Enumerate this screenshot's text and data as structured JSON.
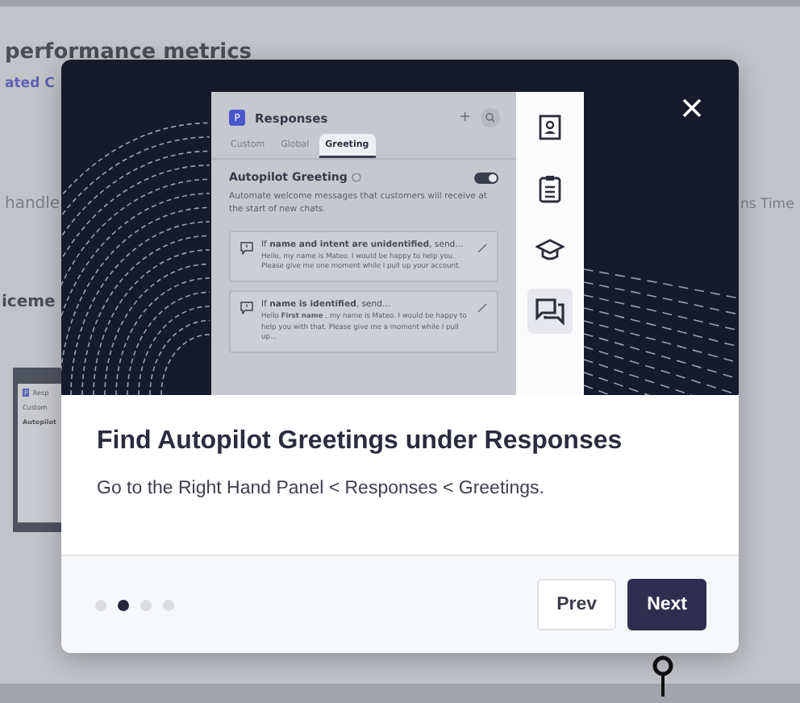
{
  "background": {
    "heading": "performance metrics",
    "link": "ated C",
    "label_left": "handle",
    "label_right": "ns Time",
    "section": "iceme",
    "thumbnail": {
      "badge": "P",
      "title": "Resp",
      "tab": "Custom",
      "heading": "Autopilot"
    }
  },
  "modal": {
    "preview": {
      "badge": "P",
      "title": "Responses",
      "add": "+",
      "tabs": [
        {
          "label": "Custom",
          "selected": false
        },
        {
          "label": "Global",
          "selected": false
        },
        {
          "label": "Greeting",
          "selected": true
        }
      ],
      "section": {
        "title": "Autopilot Greeting",
        "on": true,
        "description": "Automate welcome messages that customers will receive at the start of new chats."
      },
      "cards": [
        {
          "condition": "If **name and intent are unidentified**, send...",
          "message": "Hello, my name is Mateo. I would be happy to help you. Please give me one moment while I pull up your account."
        },
        {
          "condition": "If **name is identified**, send...",
          "message": "Hello **First name** , my name is Mateo. I would be happy to help you with that. Please give me a moment while I pull up..."
        }
      ],
      "rail": [
        {
          "kind": "contact",
          "selected": false
        },
        {
          "kind": "clipboard",
          "selected": false
        },
        {
          "kind": "course",
          "selected": false
        },
        {
          "kind": "chat",
          "selected": true
        }
      ]
    },
    "title": "Find Autopilot Greetings under Responses",
    "text": "Go to the Right Hand Panel < Responses < Greetings.",
    "steps": [
      {
        "selected": false
      },
      {
        "selected": true
      },
      {
        "selected": false
      },
      {
        "selected": false
      }
    ],
    "buttons": [
      {
        "label": "Prev",
        "kind": "secondary"
      },
      {
        "label": "Next",
        "kind": "primary"
      }
    ]
  }
}
